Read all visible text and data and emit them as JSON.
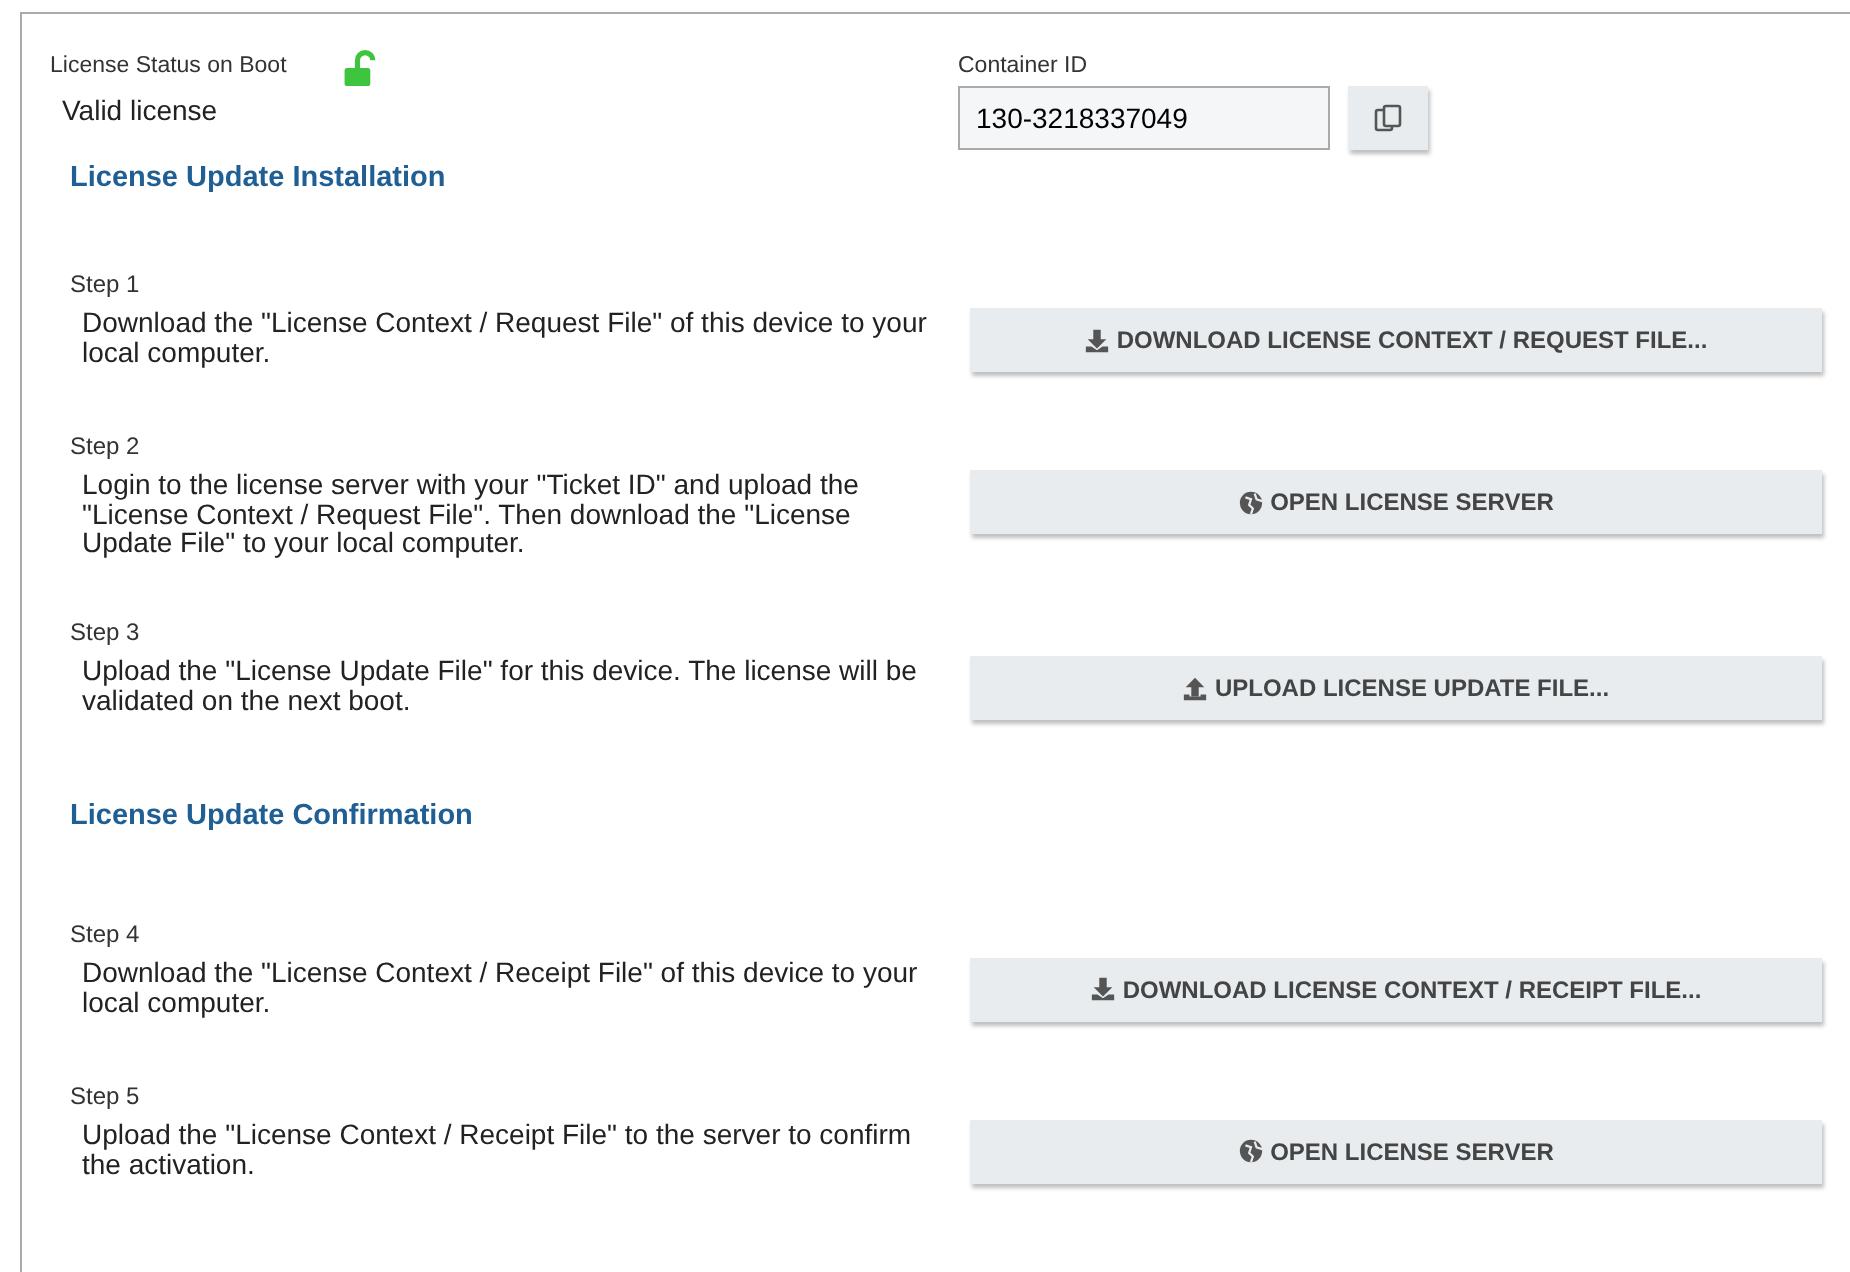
{
  "license_status": {
    "label": "License Status on Boot",
    "value": "Valid license",
    "unlocked": true
  },
  "container_id": {
    "label": "Container ID",
    "value": "130-3218337049"
  },
  "sections": [
    {
      "title": "License Update Installation",
      "steps": [
        {
          "label": "Step 1",
          "text": "Download the \"License Context / Request File\" of this device to your local computer.",
          "button": {
            "kind": "download",
            "label": "DOWNLOAD LICENSE CONTEXT / REQUEST FILE..."
          }
        },
        {
          "label": "Step 2",
          "text": "Login to the license server with your \"Ticket ID\" and upload the \"License Context / Request File\". Then download the \"License Update File\" to your local computer.",
          "button": {
            "kind": "globe",
            "label": "OPEN LICENSE SERVER"
          }
        },
        {
          "label": "Step 3",
          "text": "Upload the \"License Update File\" for this device. The license will be validated on the next boot.",
          "button": {
            "kind": "upload",
            "label": "UPLOAD LICENSE UPDATE FILE..."
          }
        }
      ]
    },
    {
      "title": "License Update Confirmation",
      "steps": [
        {
          "label": "Step 4",
          "text": "Download the \"License Context / Receipt File\" of this device to your local computer.",
          "button": {
            "kind": "download",
            "label": "DOWNLOAD LICENSE CONTEXT / RECEIPT FILE..."
          }
        },
        {
          "label": "Step 5",
          "text": "Upload the \"License Context / Receipt File\" to the server to confirm the activation.",
          "button": {
            "kind": "globe",
            "label": "OPEN LICENSE SERVER"
          }
        }
      ]
    }
  ]
}
